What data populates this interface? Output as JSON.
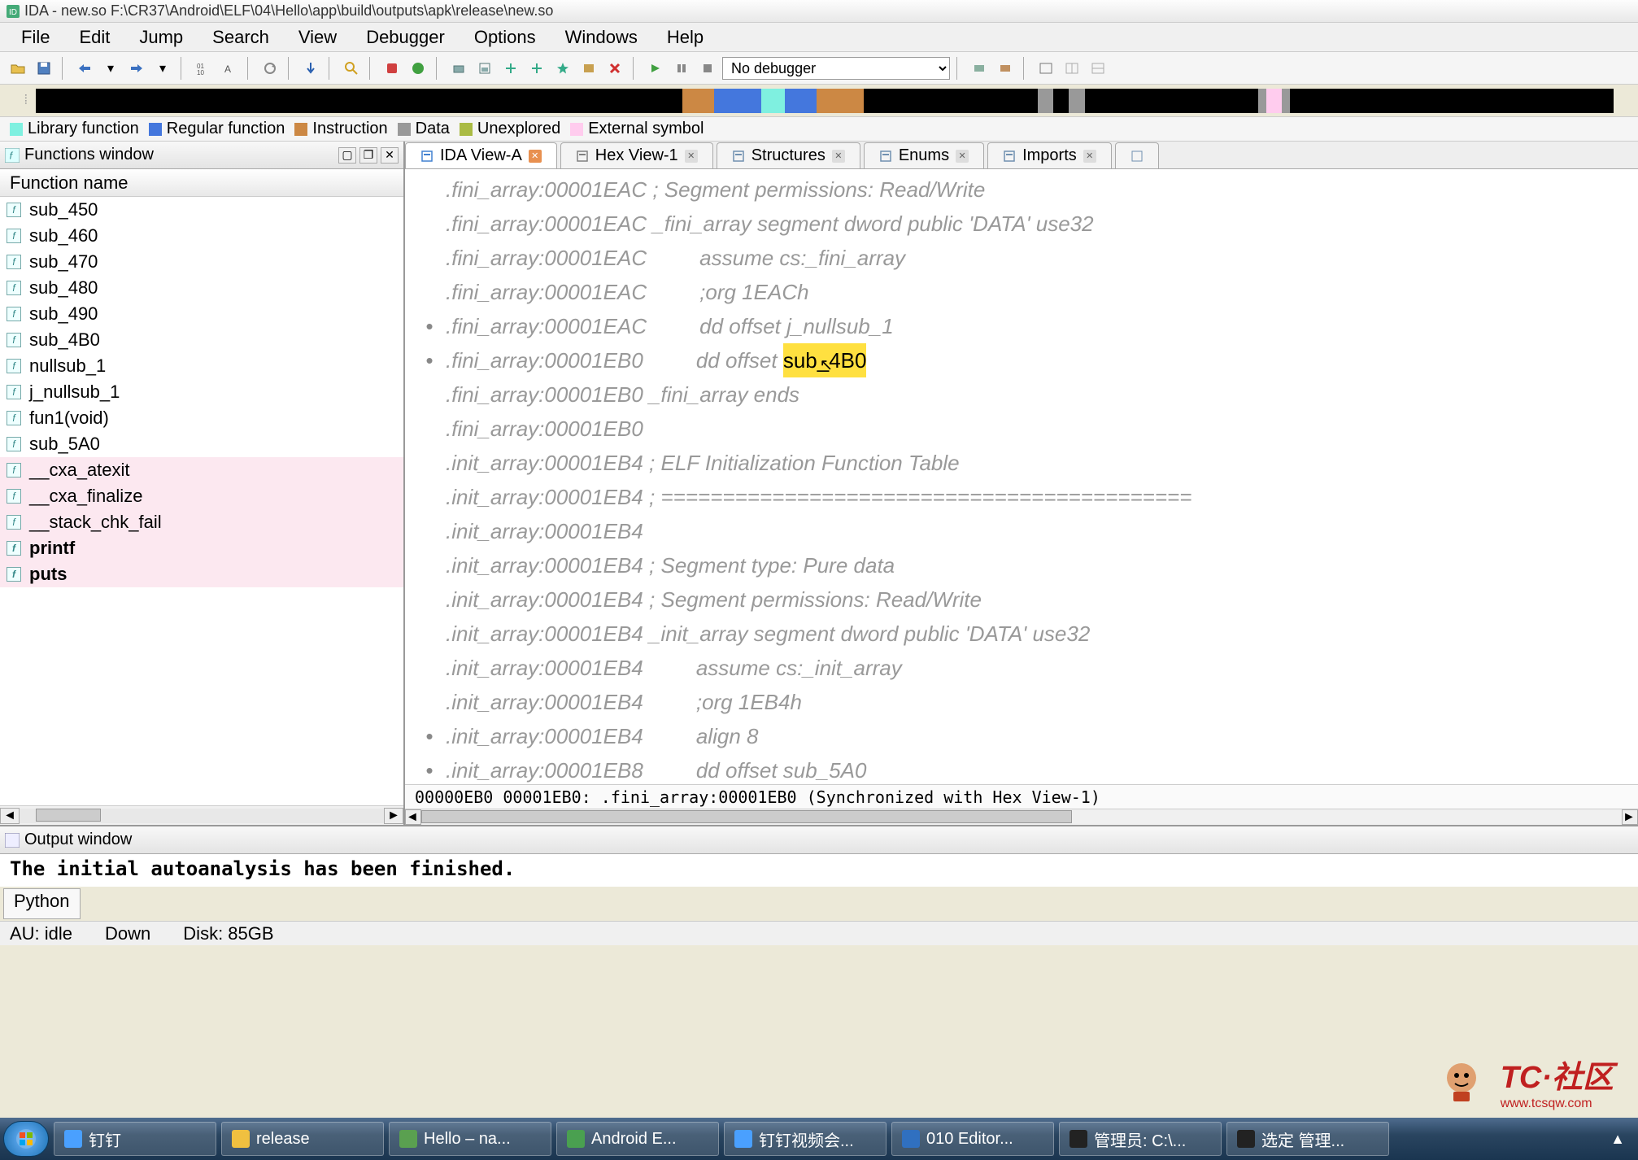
{
  "window": {
    "title": "IDA - new.so  F:\\CR37\\Android\\ELF\\04\\Hello\\app\\build\\outputs\\apk\\release\\new.so"
  },
  "menu": {
    "items": [
      "File",
      "Edit",
      "Jump",
      "Search",
      "View",
      "Debugger",
      "Options",
      "Windows",
      "Help"
    ]
  },
  "toolbar": {
    "debugger_select": "No debugger"
  },
  "legend": {
    "items": [
      {
        "color": "#7ff0e0",
        "label": "Library function"
      },
      {
        "color": "#4477dd",
        "label": "Regular function"
      },
      {
        "color": "#cc8844",
        "label": "Instruction"
      },
      {
        "color": "#999999",
        "label": "Data"
      },
      {
        "color": "#aabb44",
        "label": "Unexplored"
      },
      {
        "color": "#ffccee",
        "label": "External symbol"
      }
    ]
  },
  "functions_panel": {
    "title": "Functions window",
    "column": "Function name",
    "items": [
      {
        "name": "sub_450",
        "ext": false,
        "bold": false
      },
      {
        "name": "sub_460",
        "ext": false,
        "bold": false
      },
      {
        "name": "sub_470",
        "ext": false,
        "bold": false
      },
      {
        "name": "sub_480",
        "ext": false,
        "bold": false
      },
      {
        "name": "sub_490",
        "ext": false,
        "bold": false
      },
      {
        "name": "sub_4B0",
        "ext": false,
        "bold": false
      },
      {
        "name": "nullsub_1",
        "ext": false,
        "bold": false
      },
      {
        "name": "j_nullsub_1",
        "ext": false,
        "bold": false
      },
      {
        "name": "fun1(void)",
        "ext": false,
        "bold": false
      },
      {
        "name": "sub_5A0",
        "ext": false,
        "bold": false
      },
      {
        "name": "__cxa_atexit",
        "ext": true,
        "bold": false
      },
      {
        "name": "__cxa_finalize",
        "ext": true,
        "bold": false
      },
      {
        "name": "__stack_chk_fail",
        "ext": true,
        "bold": false
      },
      {
        "name": "printf",
        "ext": true,
        "bold": true
      },
      {
        "name": "puts",
        "ext": true,
        "bold": true
      }
    ]
  },
  "tabs": {
    "items": [
      {
        "label": "IDA View-A",
        "active": true
      },
      {
        "label": "Hex View-1",
        "active": false
      },
      {
        "label": "Structures",
        "active": false
      },
      {
        "label": "Enums",
        "active": false
      },
      {
        "label": "Imports",
        "active": false
      }
    ]
  },
  "disasm": {
    "lines": [
      {
        "gutter": "",
        "seg": ".fini_array:00001EAC",
        "rest": " ; Segment permissions: Read/Write",
        "type": "comment"
      },
      {
        "gutter": "",
        "seg": ".fini_array:00001EAC",
        "rest": " _fini_array segment dword public 'DATA' use32",
        "type": "seg"
      },
      {
        "gutter": "",
        "seg": ".fini_array:00001EAC",
        "rest": "         assume cs:_fini_array",
        "type": "asm"
      },
      {
        "gutter": "",
        "seg": ".fini_array:00001EAC",
        "rest": "         ;org 1EACh",
        "type": "comment"
      },
      {
        "gutter": "•",
        "seg": ".fini_array:00001EAC",
        "rest": "         dd offset j_nullsub_1",
        "type": "asm"
      },
      {
        "gutter": "•",
        "seg": ".fini_array:00001EB0",
        "rest": "         dd offset ",
        "type": "asm",
        "hl": "sub_4B0",
        "cursor": true
      },
      {
        "gutter": "",
        "seg": ".fini_array:00001EB0",
        "rest": " _fini_array ends",
        "type": "seg"
      },
      {
        "gutter": "",
        "seg": ".fini_array:00001EB0",
        "rest": "",
        "type": "asm"
      },
      {
        "gutter": "",
        "seg": ".init_array:00001EB4",
        "rest": " ; ELF Initialization Function Table",
        "type": "comment"
      },
      {
        "gutter": "",
        "seg": ".init_array:00001EB4",
        "rest": " ; ===========================================",
        "type": "comment"
      },
      {
        "gutter": "",
        "seg": ".init_array:00001EB4",
        "rest": "",
        "type": "asm"
      },
      {
        "gutter": "",
        "seg": ".init_array:00001EB4",
        "rest": " ; Segment type: Pure data",
        "type": "comment"
      },
      {
        "gutter": "",
        "seg": ".init_array:00001EB4",
        "rest": " ; Segment permissions: Read/Write",
        "type": "comment"
      },
      {
        "gutter": "",
        "seg": ".init_array:00001EB4",
        "rest": " _init_array segment dword public 'DATA' use32",
        "type": "seg"
      },
      {
        "gutter": "",
        "seg": ".init_array:00001EB4",
        "rest": "         assume cs:_init_array",
        "type": "asm"
      },
      {
        "gutter": "",
        "seg": ".init_array:00001EB4",
        "rest": "         ;org 1EB4h",
        "type": "comment"
      },
      {
        "gutter": "•",
        "seg": ".init_array:00001EB4",
        "rest": "         align 8",
        "type": "asm"
      },
      {
        "gutter": "•",
        "seg": ".init_array:00001EB8",
        "rest": "         dd offset sub_5A0",
        "type": "asm"
      }
    ],
    "status": "00000EB0 00001EB0: .fini_array:00001EB0 (Synchronized with Hex View-1)"
  },
  "output": {
    "title": "Output window",
    "text": "The initial autoanalysis has been finished.",
    "prompt": "Python"
  },
  "statusbar": {
    "au": "AU:  idle",
    "dir": "Down",
    "disk": "Disk: 85GB"
  },
  "taskbar": {
    "items": [
      {
        "label": "钉钉",
        "icon": "#4aa0ff"
      },
      {
        "label": "release",
        "icon": "#f0c040"
      },
      {
        "label": "Hello – na...",
        "icon": "#5aa050"
      },
      {
        "label": "Android E...",
        "icon": "#4aa050"
      },
      {
        "label": "钉钉视频会...",
        "icon": "#4aa0ff"
      },
      {
        "label": "010 Editor...",
        "icon": "#3070c0"
      },
      {
        "label": "管理员: C:\\...",
        "icon": "#222"
      },
      {
        "label": "选定 管理...",
        "icon": "#222"
      }
    ]
  },
  "watermark": {
    "text": "TC·社区",
    "sub": "www.tcsqw.com"
  }
}
